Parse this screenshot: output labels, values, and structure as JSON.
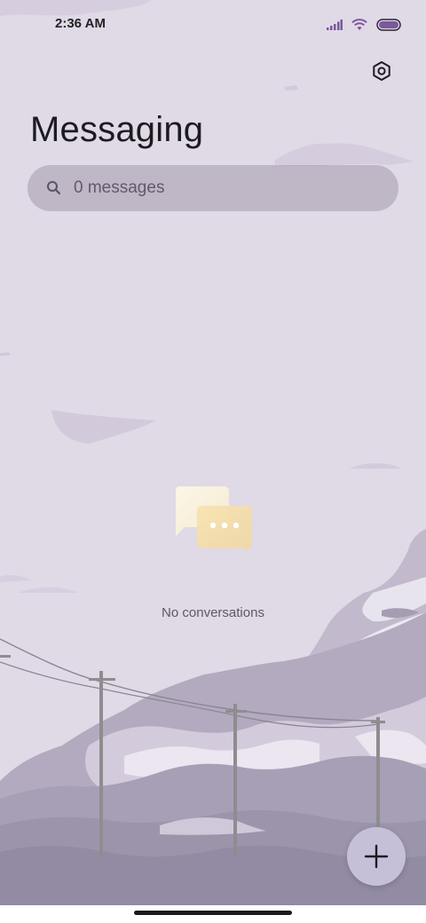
{
  "status_bar": {
    "time": "2:36 AM"
  },
  "header": {
    "title": "Messaging"
  },
  "search": {
    "placeholder": "0 messages"
  },
  "empty_state": {
    "text": "No conversations"
  },
  "icons": {
    "settings": "gear-icon",
    "search": "search-icon",
    "fab": "plus-icon",
    "signal": "signal-icon",
    "wifi": "wifi-icon",
    "battery": "battery-icon"
  },
  "colors": {
    "background": "#e0d9e6",
    "battery_fill": "#7a5a9a",
    "fab_background": "#c5c0d8"
  }
}
